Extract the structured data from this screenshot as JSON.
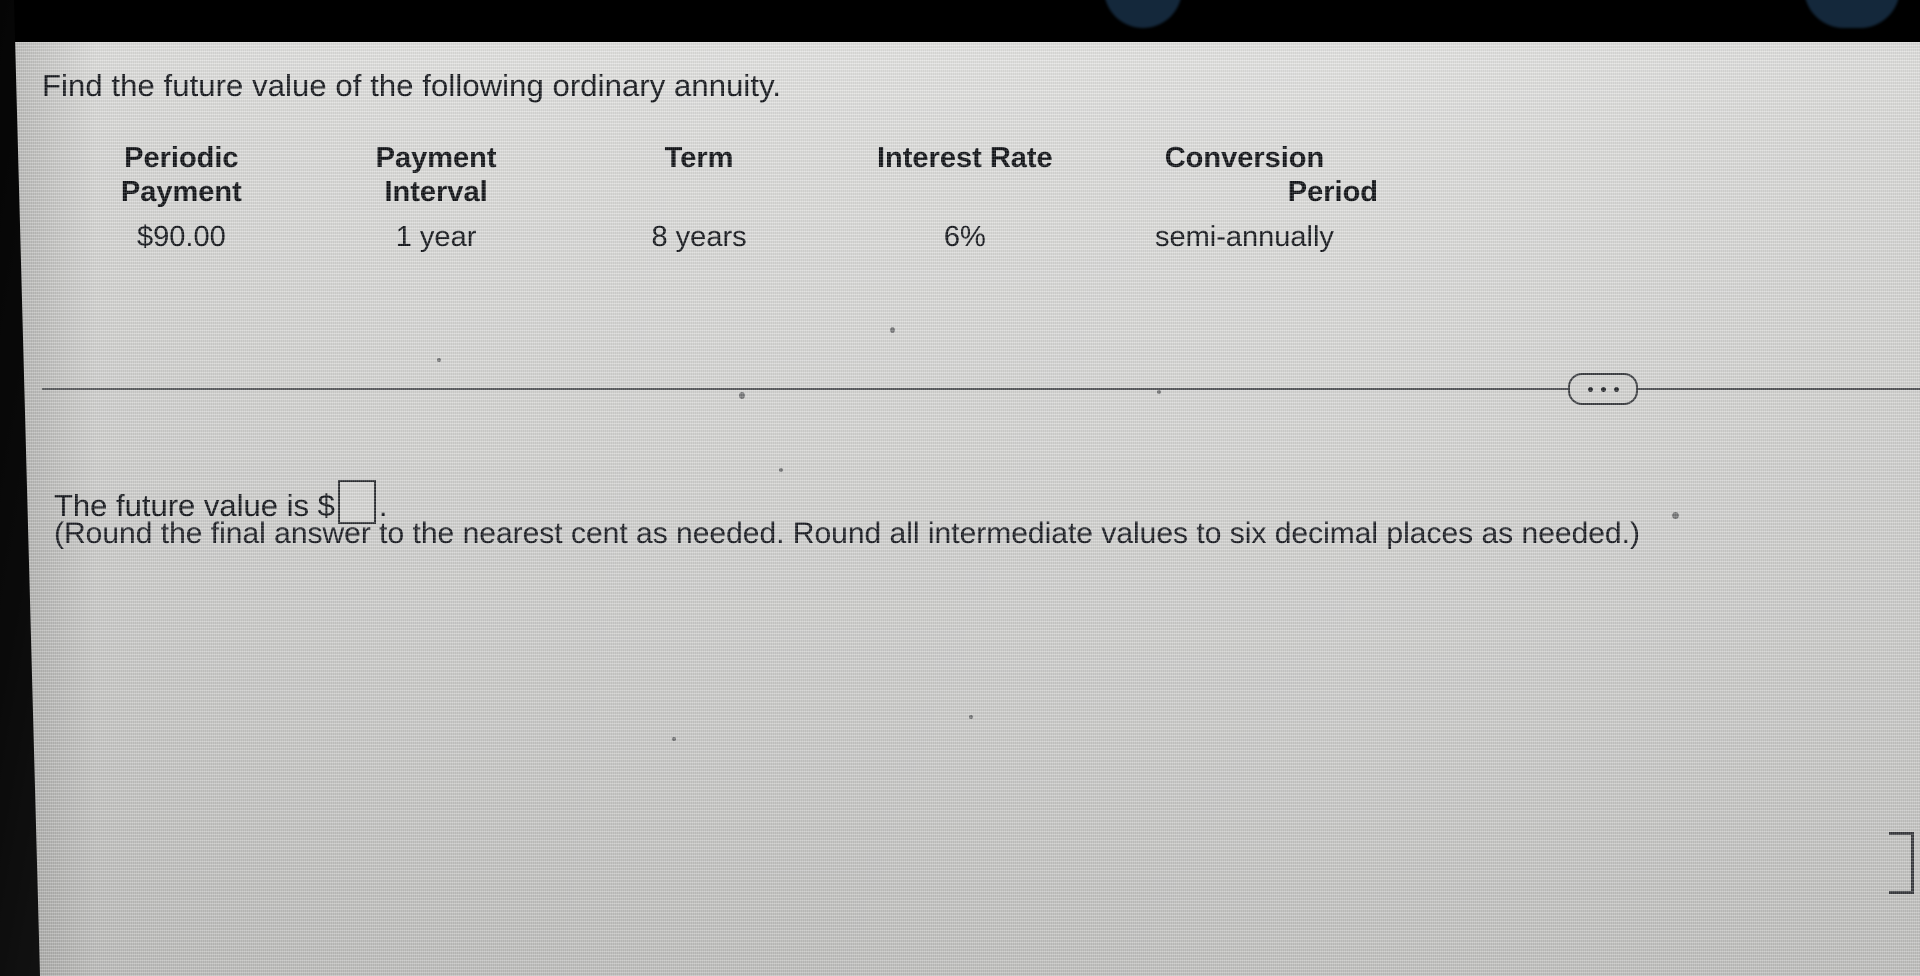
{
  "header": {
    "bar_color": "#1d5b88"
  },
  "problem": {
    "statement": "Find the future value of the following ordinary annuity."
  },
  "table": {
    "headers": [
      {
        "line1": "Periodic",
        "line2": "Payment"
      },
      {
        "line1": "Payment",
        "line2": "Interval"
      },
      {
        "line1": "Term",
        "line2": ""
      },
      {
        "line1": "Interest Rate",
        "line2": ""
      },
      {
        "line1": "Conversion",
        "line2": "Period"
      }
    ],
    "rows": [
      {
        "periodic_payment": "$90.00",
        "payment_interval": "1 year",
        "term": "8 years",
        "interest_rate": "6%",
        "conversion_period": "semi-annually"
      }
    ]
  },
  "answer": {
    "prefix": "The future value is $",
    "suffix": ".",
    "input_value": "",
    "input_placeholder": "",
    "rounding_note": "(Round the final answer to the nearest cent as needed. Round all intermediate values to six decimal places as needed.)"
  },
  "controls": {
    "more_options_label": "...",
    "more_options_icon": "ellipsis-icon"
  }
}
